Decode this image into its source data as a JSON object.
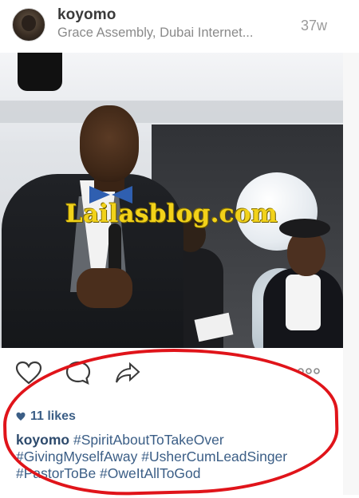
{
  "post": {
    "username": "koyomo",
    "location": "Grace Assembly, Dubai Internet...",
    "time_ago": "37w"
  },
  "photo": {
    "watermark": "Lailasblog.com"
  },
  "actions": {
    "like_icon": "heart-outline-icon",
    "comment_icon": "comment-bubble-icon",
    "share_icon": "share-arrow-icon",
    "more_icon": "more-dots-icon"
  },
  "likes": {
    "text": "11 likes"
  },
  "caption": {
    "user": "koyomo",
    "line1_tags": " #SpiritAboutToTakeOver",
    "line2": "#GivingMyselfAway #UsherCumLeadSinger",
    "line3": "#PastorToBe #OweItAllToGod"
  },
  "colors": {
    "annotation_ring": "#e0141a",
    "link_blue": "#3b5e86",
    "watermark": "#f2d21a"
  }
}
